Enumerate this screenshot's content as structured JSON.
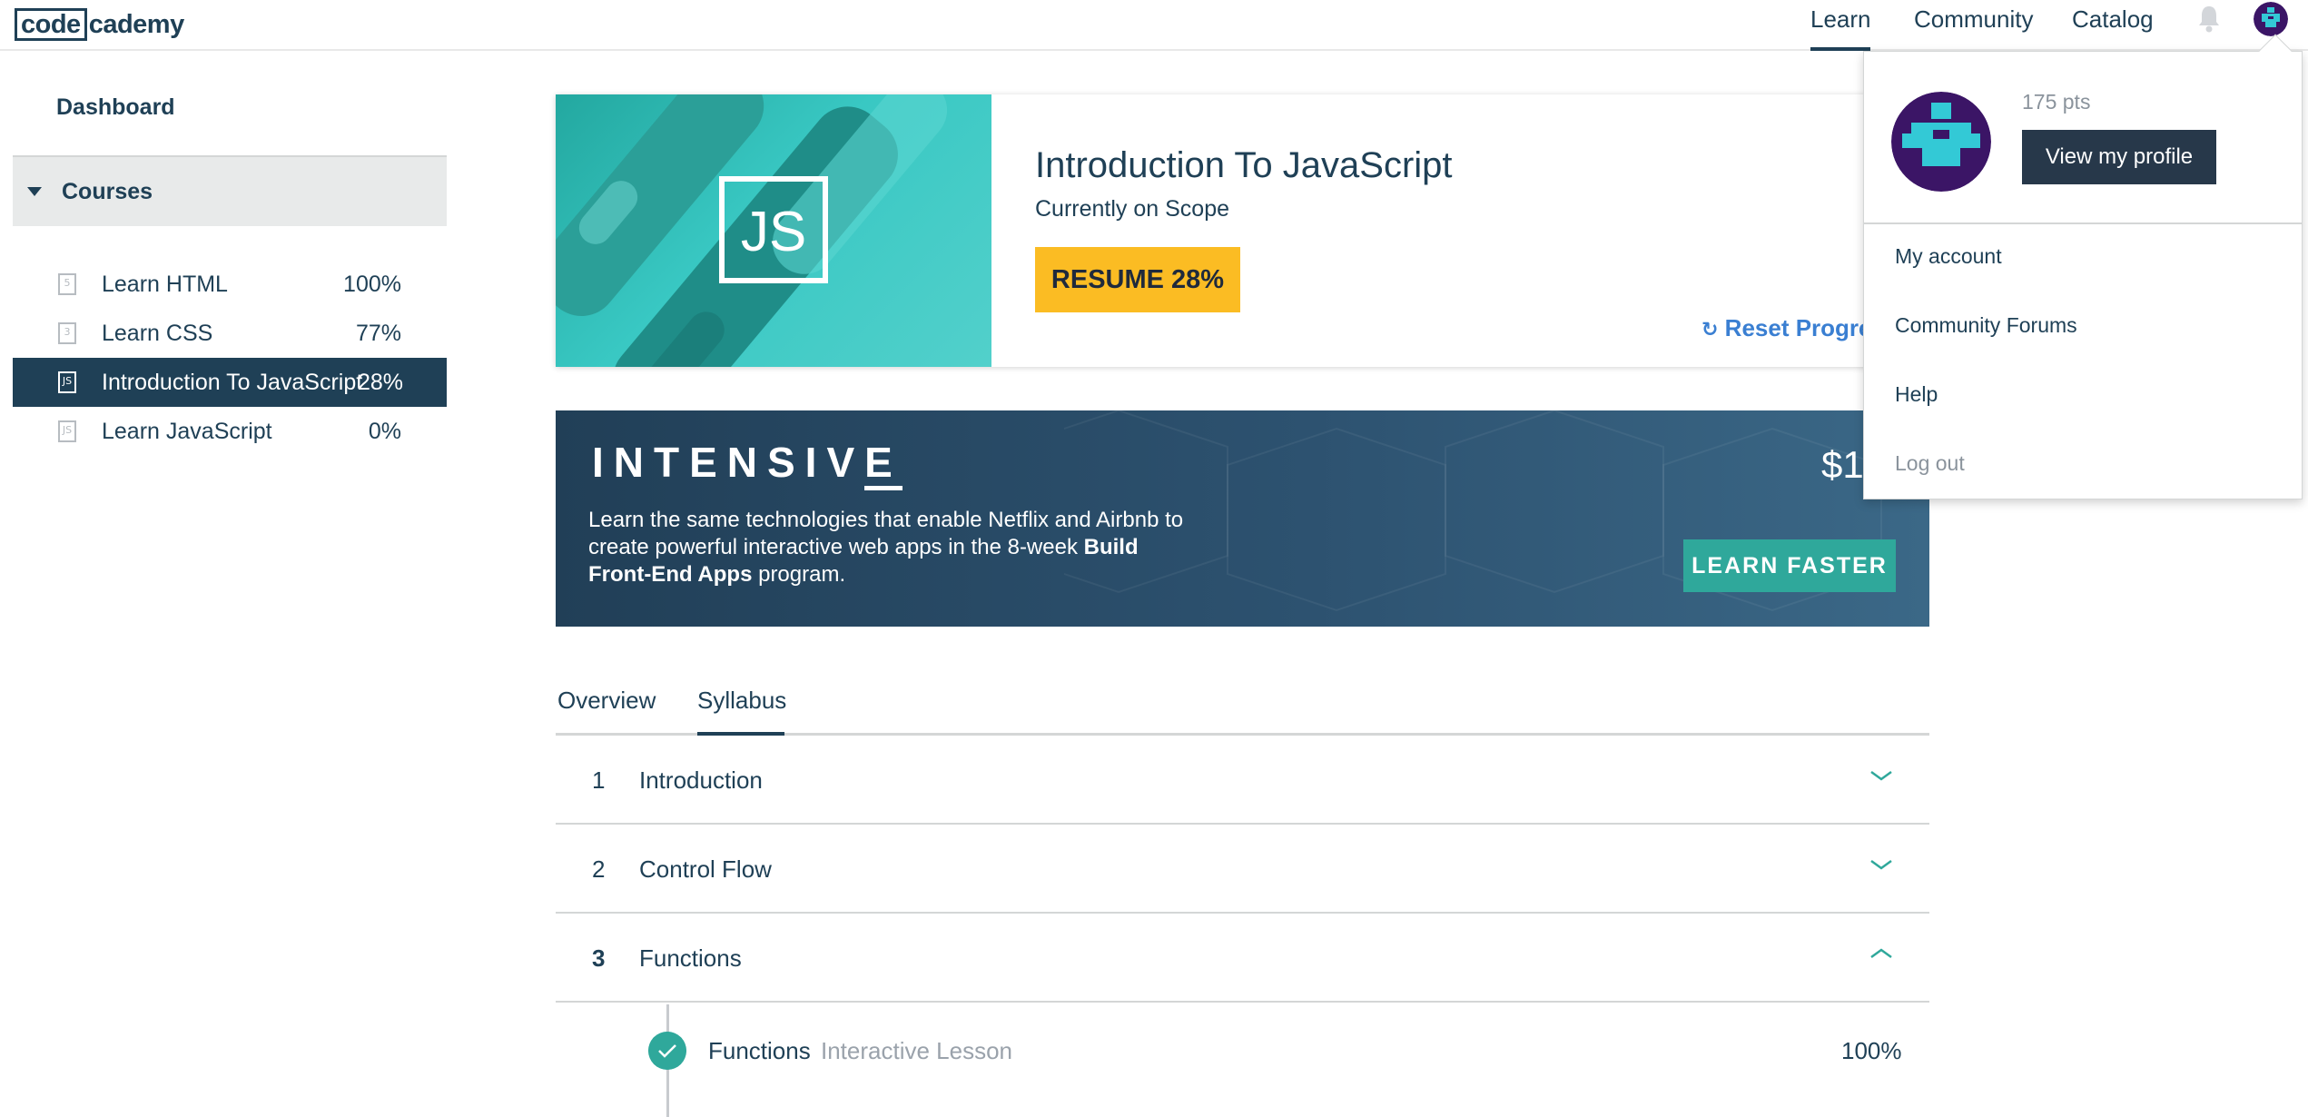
{
  "header": {
    "logo_left": "code",
    "logo_right": "cademy",
    "nav": [
      "Learn",
      "Community",
      "Catalog"
    ],
    "icons": [
      "bell-icon",
      "avatar-icon"
    ]
  },
  "sidebar": {
    "dashboard": "Dashboard",
    "courses_label": "Courses",
    "courses": [
      {
        "name": "Learn HTML",
        "pct": "100%",
        "icon": "html5-icon"
      },
      {
        "name": "Learn CSS",
        "pct": "77%",
        "icon": "css3-icon"
      },
      {
        "name": "Introduction To JavaScript",
        "pct": "28%",
        "icon": "js-icon"
      },
      {
        "name": "Learn JavaScript",
        "pct": "0%",
        "icon": "js-icon"
      }
    ]
  },
  "course_card": {
    "logo_text": "JS",
    "title": "Introduction To JavaScript",
    "subtitle": "Currently on Scope",
    "resume_label": "RESUME 28%",
    "reset_label": "Reset Progress"
  },
  "intensive": {
    "title_main": "INTENSIV",
    "title_last": "E",
    "text_1": "Learn the same technologies that enable Netflix and Airbnb to create powerful interactive web apps in the 8-week ",
    "text_bold": "Build Front-End Apps",
    "text_2": " program.",
    "price": "$1",
    "button": "LEARN FASTER"
  },
  "tabs": [
    "Overview",
    "Syllabus"
  ],
  "syllabus": [
    {
      "num": "1",
      "title": "Introduction",
      "expanded": false
    },
    {
      "num": "2",
      "title": "Control Flow",
      "expanded": false
    },
    {
      "num": "3",
      "title": "Functions",
      "expanded": true
    }
  ],
  "lesson": {
    "name": "Functions",
    "type": "Interactive Lesson",
    "pct": "100%",
    "completed": true
  },
  "profile_menu": {
    "points": "175 pts",
    "view_profile": "View my profile",
    "items": [
      "My account",
      "Community Forums",
      "Help",
      "Log out"
    ]
  },
  "colors": {
    "navy": "#1f4056",
    "resume_yellow": "#fbbc23",
    "teal": "#2fa89b",
    "link_blue": "#3a7fd2"
  }
}
